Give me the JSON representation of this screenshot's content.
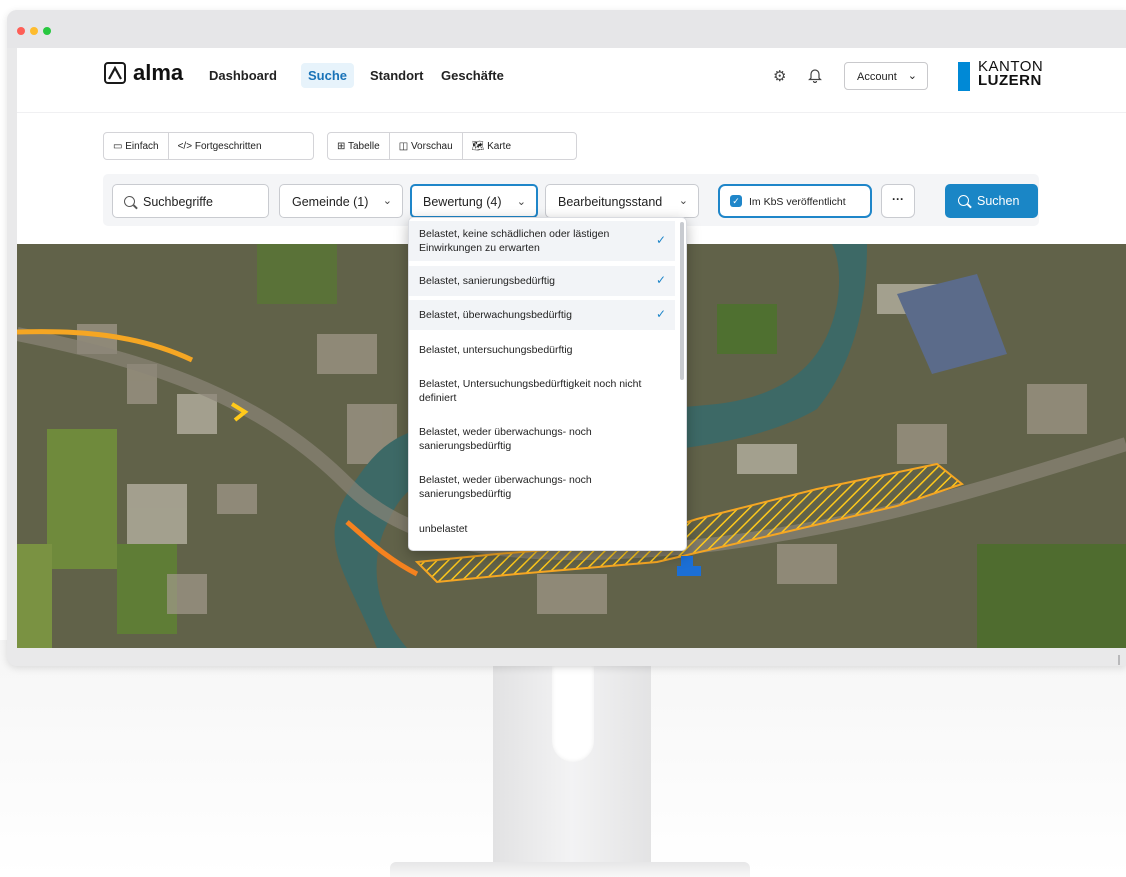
{
  "window": {
    "dot_colors": [
      "#fe5f57",
      "#febc2e",
      "#28c840"
    ]
  },
  "header": {
    "logo_text": "alma",
    "nav": [
      {
        "label": "Dashboard",
        "active": false
      },
      {
        "label": "Suche",
        "active": true
      },
      {
        "label": "Standort",
        "active": false
      },
      {
        "label": "Geschäfte",
        "active": false
      }
    ],
    "account_label": "Account",
    "brand_line1": "KANTON",
    "brand_line2": "LUZERN",
    "brand_color": "#0089d6"
  },
  "modebar": {
    "search_modes": [
      {
        "label": "Einfach",
        "icon": "simple-mode-icon"
      },
      {
        "label": "Fortgeschritten",
        "icon": "code-icon"
      }
    ],
    "view_modes": [
      {
        "label": "Tabelle",
        "icon": "table-icon"
      },
      {
        "label": "Vorschau",
        "icon": "preview-icon"
      },
      {
        "label": "Karte",
        "icon": "map-icon"
      }
    ]
  },
  "filters": {
    "search_placeholder": "Suchbegriffe",
    "gemeinde_label": "Gemeinde (1)",
    "bewertung_label": "Bewertung (4)",
    "bearbeitungsstand_label": "Bearbeitungsstand",
    "kbs_label": "Im KbS veröffentlicht",
    "kbs_checked": true,
    "more_label": "···",
    "search_button_label": "Suchen",
    "accent_color": "#1a86c6"
  },
  "dropdown": {
    "options": [
      {
        "label": "Belastet, keine schädlichen oder lästigen Einwirkungen zu erwarten",
        "selected": true
      },
      {
        "label": "Belastet, sanierungsbedürftig",
        "selected": true
      },
      {
        "label": "Belastet, überwachungsbedürftig",
        "selected": true
      },
      {
        "label": "Belastet, untersuchungsbedürftig",
        "selected": false
      },
      {
        "label": "Belastet, Untersuchungsbedürftigkeit noch nicht definiert",
        "selected": false
      },
      {
        "label": "Belastet, weder überwachungs- noch sanierungsbedürftig",
        "selected": false
      },
      {
        "label": "Belastet, weder überwachungs- noch sanierungsbedürftig",
        "selected": false
      },
      {
        "label": "unbelastet",
        "selected": false
      }
    ],
    "check_glyph": "✓"
  },
  "map": {
    "area_color": "#f5a623",
    "highlight_color": "#ffc91a",
    "marker_color": "#1b6fd6"
  }
}
